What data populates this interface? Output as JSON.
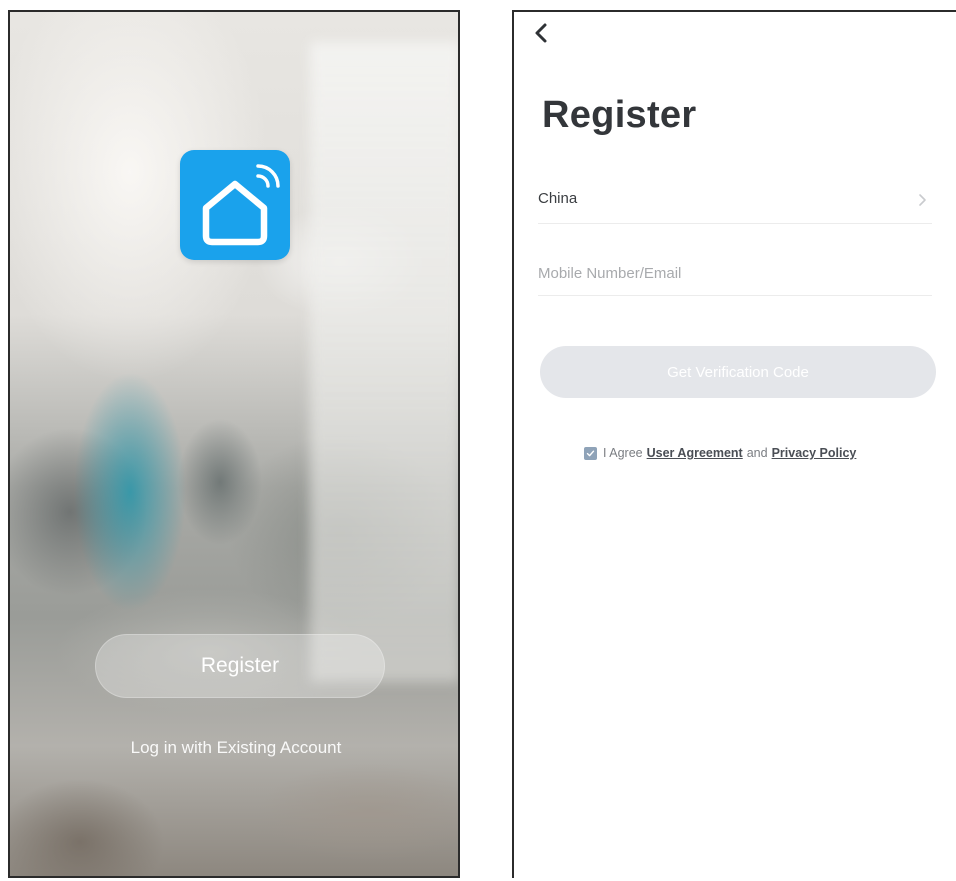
{
  "left_screen": {
    "register_button_label": "Register",
    "login_link_label": "Log in with Existing Account",
    "app_icon": "smart-home-icon",
    "app_icon_color": "#1aa2ec"
  },
  "right_screen": {
    "back_icon": "chevron-left-icon",
    "title": "Register",
    "country": {
      "value": "China",
      "icon": "chevron-right-icon"
    },
    "account_input": {
      "value": "",
      "placeholder": "Mobile Number/Email"
    },
    "verify_button_label": "Get Verification Code",
    "agreement": {
      "checked": true,
      "prefix": "I Agree",
      "user_agreement_label": "User Agreement",
      "and_label": "and",
      "privacy_policy_label": "Privacy Policy"
    },
    "colors": {
      "button_disabled": "#e4e6ea",
      "checkbox": "#8fa3b8",
      "title": "#33363a"
    }
  }
}
